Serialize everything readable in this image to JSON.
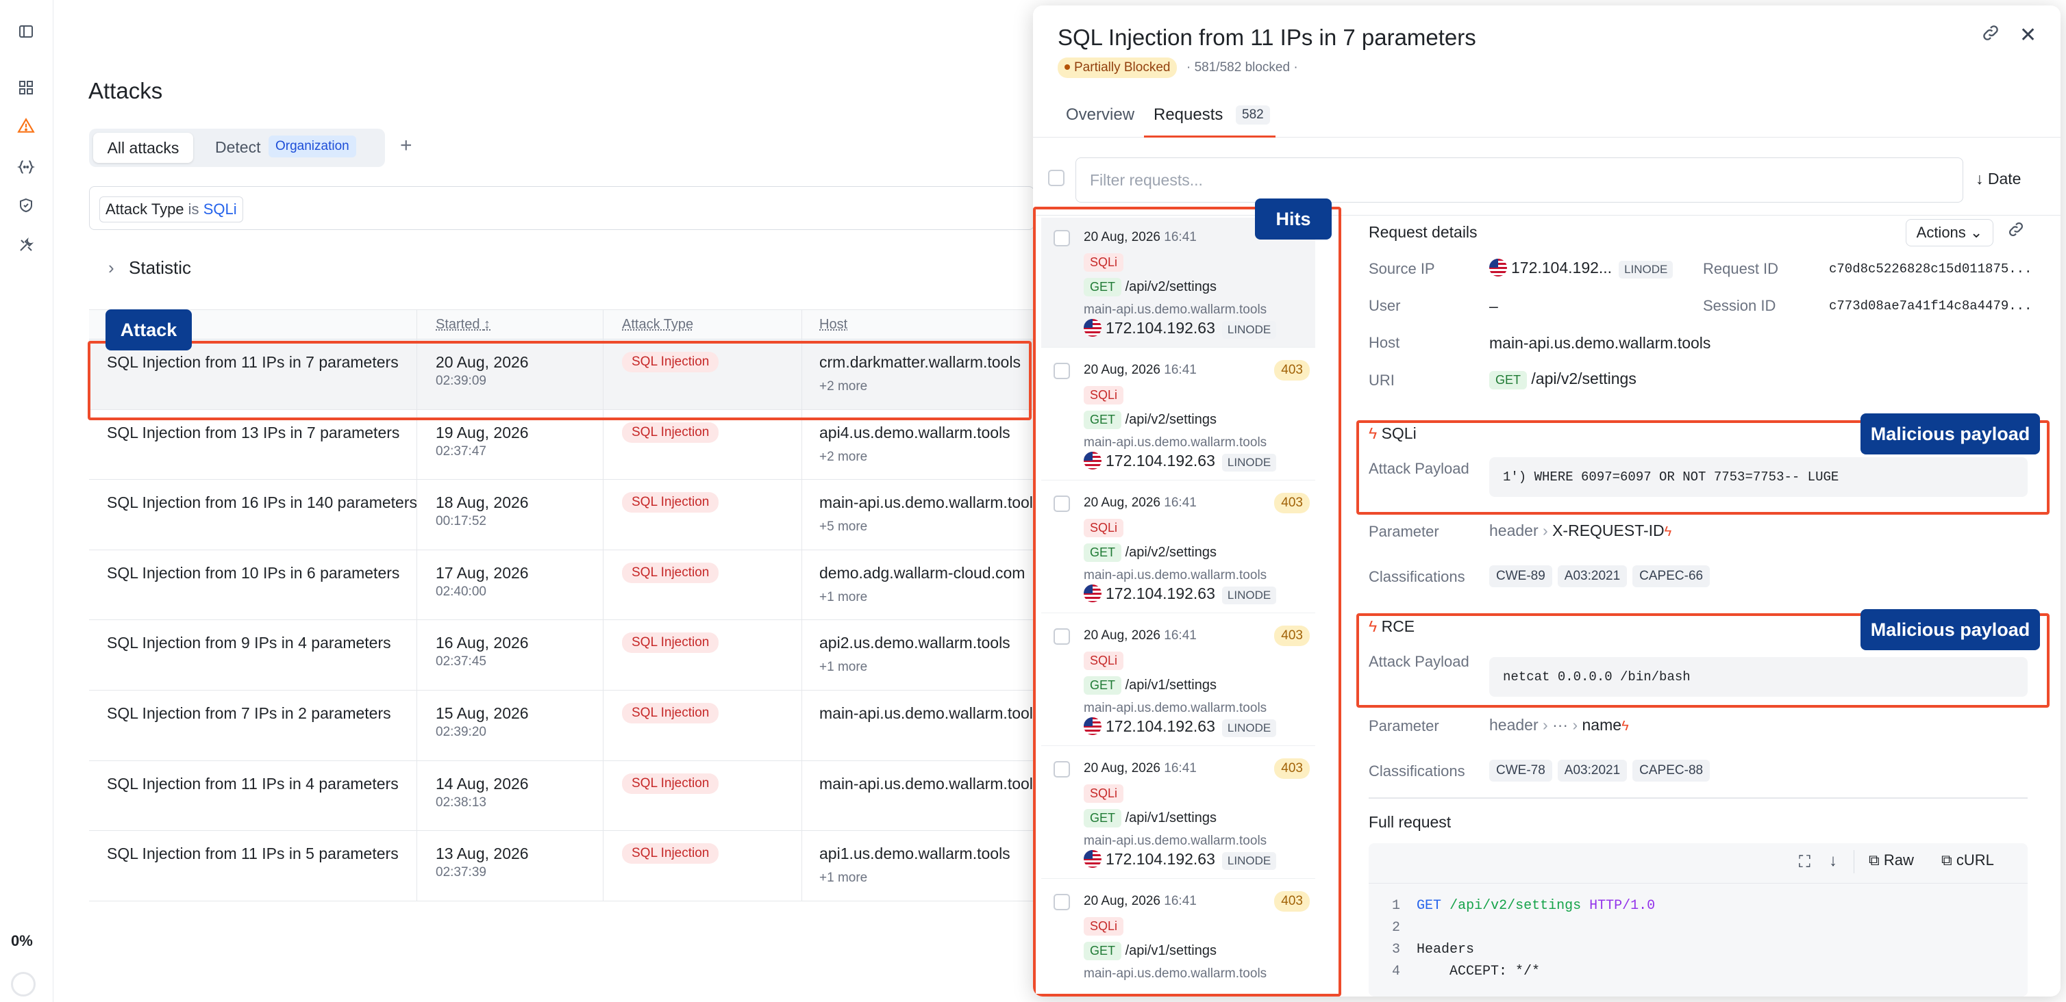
{
  "rail": {
    "progress": "0%"
  },
  "main": {
    "title": "Attacks",
    "tabs": {
      "all": "All attacks",
      "detect": "Detect",
      "org_badge": "Organization",
      "add": "+"
    },
    "filter": {
      "field": "Attack Type",
      "op": "is",
      "value": "SQLi"
    },
    "statistic": "Statistic",
    "columns": {
      "started": "Started",
      "type": "Attack Type",
      "host": "Host"
    },
    "rows": [
      {
        "name": "SQL Injection from 11 IPs in 7 parameters",
        "date": "20 Aug, 2026",
        "time": "02:39:09",
        "type": "SQL Injection",
        "host": "crm.darkmatter.wallarm.tools",
        "more": "+2 more"
      },
      {
        "name": "SQL Injection from 13 IPs in 7 parameters",
        "date": "19 Aug, 2026",
        "time": "02:37:47",
        "type": "SQL Injection",
        "host": "api4.us.demo.wallarm.tools",
        "more": "+2 more"
      },
      {
        "name": "SQL Injection from 16 IPs in 140 parameters",
        "date": "18 Aug, 2026",
        "time": "00:17:52",
        "type": "SQL Injection",
        "host": "main-api.us.demo.wallarm.tools",
        "more": "+5 more"
      },
      {
        "name": "SQL Injection from 10 IPs in 6 parameters",
        "date": "17 Aug, 2026",
        "time": "02:40:00",
        "type": "SQL Injection",
        "host": "demo.adg.wallarm-cloud.com",
        "more": "+1 more"
      },
      {
        "name": "SQL Injection from 9 IPs in 4 parameters",
        "date": "16 Aug, 2026",
        "time": "02:37:45",
        "type": "SQL Injection",
        "host": "api2.us.demo.wallarm.tools",
        "more": "+1 more"
      },
      {
        "name": "SQL Injection from 7 IPs in 2 parameters",
        "date": "15 Aug, 2026",
        "time": "02:39:20",
        "type": "SQL Injection",
        "host": "main-api.us.demo.wallarm.tools",
        "more": ""
      },
      {
        "name": "SQL Injection from 11 IPs in 4 parameters",
        "date": "14 Aug, 2026",
        "time": "02:38:13",
        "type": "SQL Injection",
        "host": "main-api.us.demo.wallarm.tools",
        "more": ""
      },
      {
        "name": "SQL Injection from 11 IPs in 5 parameters",
        "date": "13 Aug, 2026",
        "time": "02:37:39",
        "type": "SQL Injection",
        "host": "api1.us.demo.wallarm.tools",
        "more": "+1 more"
      }
    ]
  },
  "panel": {
    "title": "SQL Injection from 11 IPs in 7 parameters",
    "status": "Partially Blocked",
    "blocked": "· 581/582 blocked ·",
    "tabs": {
      "overview": "Overview",
      "requests": "Requests",
      "count": "582"
    },
    "filter_placeholder": "Filter requests...",
    "sort": "Date",
    "hits": [
      {
        "date": "20 Aug, 2026",
        "time": "16:41",
        "code": "",
        "type": "SQLi",
        "method": "GET",
        "path": "/api/v2/settings",
        "host": "main-api.us.demo.wallarm.tools",
        "ip": "172.104.192.63",
        "asn": "LINODE"
      },
      {
        "date": "20 Aug, 2026",
        "time": "16:41",
        "code": "403",
        "type": "SQLi",
        "method": "GET",
        "path": "/api/v2/settings",
        "host": "main-api.us.demo.wallarm.tools",
        "ip": "172.104.192.63",
        "asn": "LINODE"
      },
      {
        "date": "20 Aug, 2026",
        "time": "16:41",
        "code": "403",
        "type": "SQLi",
        "method": "GET",
        "path": "/api/v2/settings",
        "host": "main-api.us.demo.wallarm.tools",
        "ip": "172.104.192.63",
        "asn": "LINODE"
      },
      {
        "date": "20 Aug, 2026",
        "time": "16:41",
        "code": "403",
        "type": "SQLi",
        "method": "GET",
        "path": "/api/v1/settings",
        "host": "main-api.us.demo.wallarm.tools",
        "ip": "172.104.192.63",
        "asn": "LINODE"
      },
      {
        "date": "20 Aug, 2026",
        "time": "16:41",
        "code": "403",
        "type": "SQLi",
        "method": "GET",
        "path": "/api/v1/settings",
        "host": "main-api.us.demo.wallarm.tools",
        "ip": "172.104.192.63",
        "asn": "LINODE"
      },
      {
        "date": "20 Aug, 2026",
        "time": "16:41",
        "code": "403",
        "type": "SQLi",
        "method": "GET",
        "path": "/api/v1/settings",
        "host": "main-api.us.demo.wallarm.tools",
        "ip": "",
        "asn": ""
      }
    ],
    "details": {
      "heading": "Request details",
      "actions": "Actions",
      "source_ip_label": "Source IP",
      "source_ip": "172.104.192...",
      "source_asn": "LINODE",
      "request_id_label": "Request ID",
      "request_id": "c70d8c5226828c15d011875...",
      "user_label": "User",
      "user": "–",
      "session_id_label": "Session ID",
      "session_id": "c773d08ae7a41f14c8a4479...",
      "host_label": "Host",
      "host": "main-api.us.demo.wallarm.tools",
      "uri_label": "URI",
      "uri_method": "GET",
      "uri": "/api/v2/settings"
    },
    "sqli": {
      "title": "SQLi",
      "payload_label": "Attack Payload",
      "payload": "1') WHERE 6097=6097 OR NOT 7753=7753-- LUGE",
      "param_label": "Parameter",
      "param_prefix": "header",
      "param": "X-REQUEST-ID",
      "class_label": "Classifications",
      "classes": [
        "CWE-89",
        "A03:2021",
        "CAPEC-66"
      ]
    },
    "rce": {
      "title": "RCE",
      "payload_label": "Attack Payload",
      "payload": "netcat 0.0.0.0 /bin/bash",
      "param_label": "Parameter",
      "param_prefix": "header",
      "param_mid": "···",
      "param": "name",
      "class_label": "Classifications",
      "classes": [
        "CWE-78",
        "A03:2021",
        "CAPEC-88"
      ]
    },
    "full_request": {
      "heading": "Full request",
      "raw": "Raw",
      "curl": "cURL",
      "lines": [
        {
          "n": "1",
          "method": "GET",
          "path": "/api/v2/settings",
          "proto": "HTTP/1.0"
        },
        {
          "n": "2",
          "text": ""
        },
        {
          "n": "3",
          "text": "Headers"
        },
        {
          "n": "4",
          "text": "    ACCEPT: */*"
        }
      ]
    }
  },
  "annotations": {
    "attack": "Attack",
    "hits": "Hits",
    "payload1": "Malicious payload",
    "payload2": "Malicious payload"
  },
  "colors": {
    "accent": "#ee4b2b",
    "annotation_bg": "#0b3d91",
    "link": "#2563eb"
  }
}
